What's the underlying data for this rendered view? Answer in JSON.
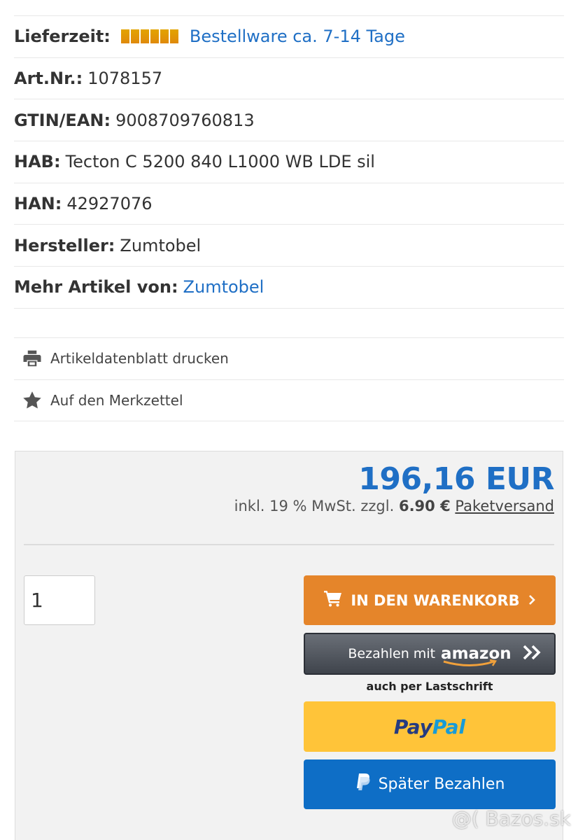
{
  "details": {
    "lieferzeit": {
      "label": "Lieferzeit:",
      "value": "Bestellware ca. 7-14 Tage",
      "bar_color": "#e0920a"
    },
    "artnr": {
      "label": "Art.Nr.:",
      "value": "1078157"
    },
    "gtin": {
      "label": "GTIN/EAN:",
      "value": "9008709760813"
    },
    "hab": {
      "label": "HAB:",
      "value": "Tecton C 5200 840 L1000 WB LDE sil"
    },
    "han": {
      "label": "HAN:",
      "value": "42927076"
    },
    "hersteller": {
      "label": "Hersteller:",
      "value": "Zumtobel"
    },
    "mehr": {
      "label": "Mehr Artikel von:",
      "value": "Zumtobel"
    }
  },
  "actions": {
    "print": {
      "label": "Artikeldatenblatt drucken",
      "icon": "printer-icon"
    },
    "wishlist": {
      "label": "Auf den Merkzettel",
      "icon": "star-icon"
    }
  },
  "buybox": {
    "price": "196,16 EUR",
    "tax_prefix": "inkl. 19 % MwSt. zzgl.",
    "shipping_cost": "6.90 €",
    "shipping_link": "Paketversand",
    "quantity": "1",
    "cart_button": "IN DEN WARENKORB",
    "amazon_prefix": "Bezahlen mit",
    "amazon_brand": "amazon",
    "lastschrift": "auch per Lastschrift",
    "paypal_part1": "Pay",
    "paypal_part2": "Pal",
    "later_button": "Später Bezahlen",
    "accent_color": "#1f6fc5",
    "cart_color": "#e5852a",
    "paypal_color": "#ffc439",
    "later_color": "#0e6ec6"
  },
  "watermark": "@( Bazos.sk"
}
